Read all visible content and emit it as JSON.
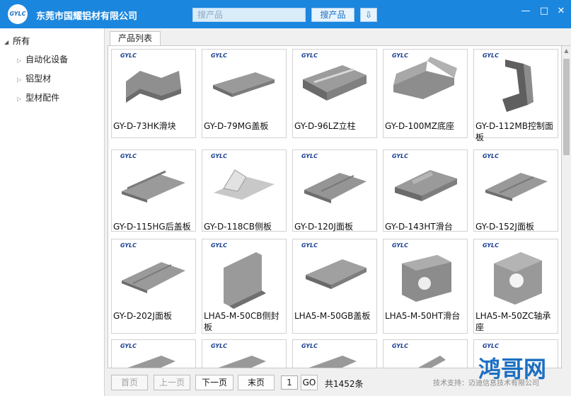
{
  "app": {
    "title": "东莞市国耀铝材有限公司",
    "logo_text": "GYLC",
    "search_placeholder": "搜产品",
    "search_button": "搜产品",
    "download_icon": "download-icon",
    "window_controls": [
      "minimize-icon",
      "maximize-icon",
      "close-icon"
    ]
  },
  "sidebar": {
    "root": "所有",
    "items": [
      {
        "label": "自动化设备"
      },
      {
        "label": "铝型材"
      },
      {
        "label": "型材配件"
      }
    ]
  },
  "tabs": [
    {
      "label": "产品列表"
    }
  ],
  "products": [
    {
      "name": "GY-D-73HK滑块"
    },
    {
      "name": "GY-D-79MG盖板"
    },
    {
      "name": "GY-D-96LZ立柱"
    },
    {
      "name": "GY-D-100MZ底座"
    },
    {
      "name": "GY-D-112MB控制面板"
    },
    {
      "name": "GY-D-115HG后盖板"
    },
    {
      "name": "GY-D-118CB侧板"
    },
    {
      "name": "GY-D-120J面板"
    },
    {
      "name": "GY-D-143HT滑台"
    },
    {
      "name": "GY-D-152J面板"
    },
    {
      "name": "GY-D-202J面板"
    },
    {
      "name": "LHA5-M-50CB侧封板"
    },
    {
      "name": "LHA5-M-50GB盖板"
    },
    {
      "name": "LHA5-M-50HT滑台"
    },
    {
      "name": "LHA5-M-50ZC轴承座"
    },
    {
      "name": ""
    },
    {
      "name": ""
    },
    {
      "name": ""
    },
    {
      "name": ""
    },
    {
      "name": ""
    }
  ],
  "pager": {
    "first": "首页",
    "prev": "上一页",
    "next": "下一页",
    "last": "末页",
    "page": "1",
    "go": "GO",
    "total": "共1452条"
  },
  "watermark": {
    "brand": "鸿哥网",
    "support": "技术支持：迈迪信息技术有限公司"
  }
}
